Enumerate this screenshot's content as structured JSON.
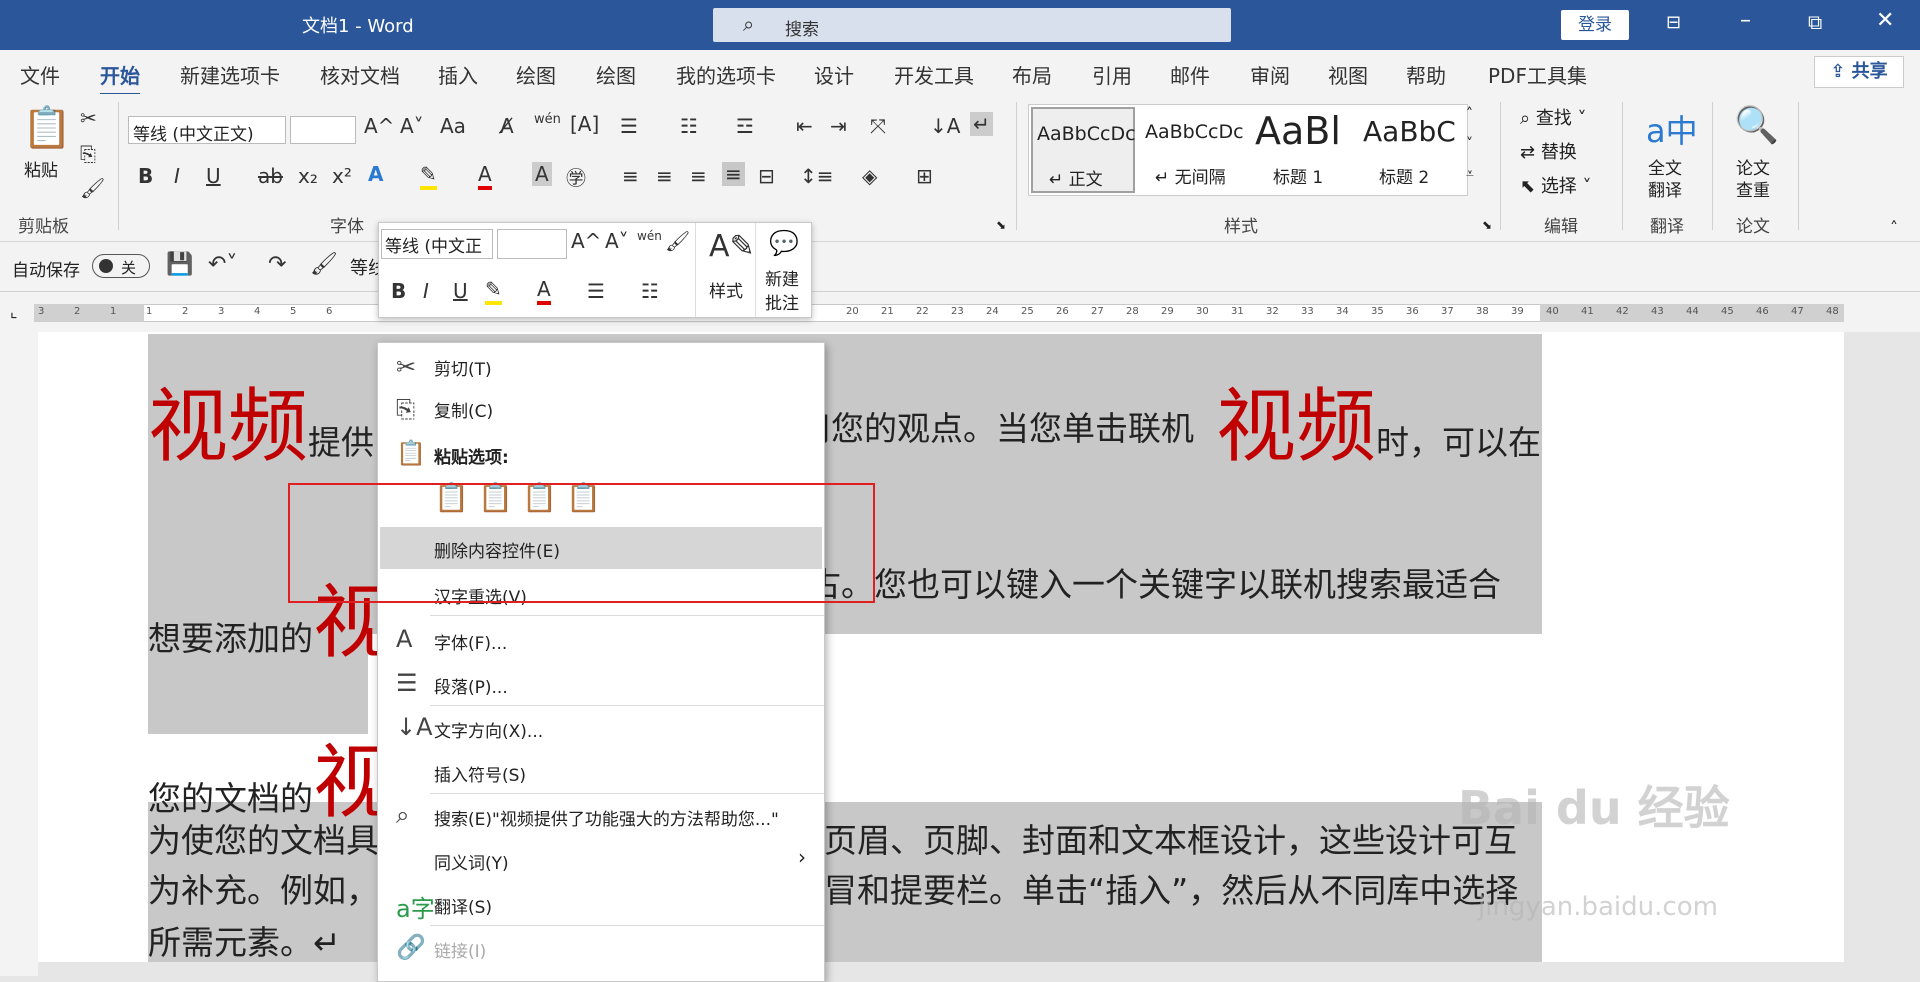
{
  "window": {
    "title": "文档1  -  Word",
    "search_placeholder": "搜索",
    "login": "登录"
  },
  "tabs": [
    "文件",
    "开始",
    "新建选项卡",
    "核对文档",
    "插入",
    "绘图",
    "绘图",
    "我的选项卡",
    "设计",
    "开发工具",
    "布局",
    "引用",
    "邮件",
    "审阅",
    "视图",
    "帮助",
    "PDF工具集"
  ],
  "share": "共享",
  "ribbon": {
    "clipboard": {
      "paste": "粘贴",
      "group": "剪贴板"
    },
    "font": {
      "name": "等线 (中文正文)",
      "group": "字体",
      "grow": "A^",
      "shrink": "A˅",
      "aa": "Aa",
      "bold": "B",
      "italic": "I",
      "underline": "U",
      "strike": "ab",
      "sub": "x₂",
      "sup": "x²"
    },
    "styles": {
      "group": "样式",
      "items": [
        {
          "preview": "AaBbCcDc",
          "name": "↵ 正文"
        },
        {
          "preview": "AaBbCcDc",
          "name": "↵ 无间隔"
        },
        {
          "preview": "AaBl",
          "name": "标题 1"
        },
        {
          "preview": "AaBbC",
          "name": "标题 2"
        }
      ]
    },
    "editing": {
      "find": "查找",
      "replace": "替换",
      "select": "选择",
      "group": "编辑"
    },
    "translate": {
      "label1": "全文",
      "label2": "翻译",
      "group": "翻译"
    },
    "paper": {
      "label1": "论文",
      "label2": "查重",
      "group": "论文"
    }
  },
  "qat": {
    "autosave": "自动保存",
    "toggle": "关",
    "font_partial": "等线"
  },
  "ruler": {
    "left_numbers": [
      "3",
      "2",
      "1",
      "1",
      "2",
      "3",
      "4",
      "5",
      "6"
    ],
    "right_numbers": [
      "20",
      "21",
      "22",
      "23",
      "24",
      "25",
      "26",
      "27",
      "28",
      "29",
      "30",
      "31",
      "32",
      "33",
      "34",
      "35",
      "36",
      "37",
      "38",
      "39",
      "40",
      "41",
      "42",
      "43",
      "44",
      "45",
      "46",
      "47",
      "48"
    ]
  },
  "minitoolbar": {
    "font": "等线 (中文正",
    "styles": "样式",
    "new1": "新建",
    "new2": "批注"
  },
  "doc": {
    "big": "视频",
    "l1a": "提供",
    "l1b": "用您的观点。当您单击联机",
    "l1c": "时，可以在",
    "l2a": "想要添加的",
    "l2big": "视",
    "l2b": "古。您也可以键入一个关键字以联机搜索最适合",
    "l3a": "您的文档的",
    "l3big": "视",
    "l4a": "为使您的文档具",
    "l4b": "页眉、页脚、封面和文本框设计，这些设计可互",
    "l5a": "为补充。例如，",
    "l5b": "冒和提要栏。单击“插入”，然后从不同库中选择",
    "l6": "所需元素。↵"
  },
  "context_menu": {
    "cut": "剪切(T)",
    "copy": "复制(C)",
    "paste_options": "粘贴选项:",
    "delete_cc": "删除内容控件(E)",
    "reconvert": "汉字重选(V)",
    "font": "字体(F)...",
    "paragraph": "段落(P)...",
    "text_direction": "文字方向(X)...",
    "insert_symbol": "插入符号(S)",
    "search": "搜索(E)\"视频提供了功能强大的方法帮助您...\"",
    "synonyms": "同义词(Y)",
    "translate": "翻译(S)",
    "link": "链接(I)"
  },
  "watermark": {
    "brand": "Bai du 经验",
    "url": "jingyan.baidu.com"
  }
}
